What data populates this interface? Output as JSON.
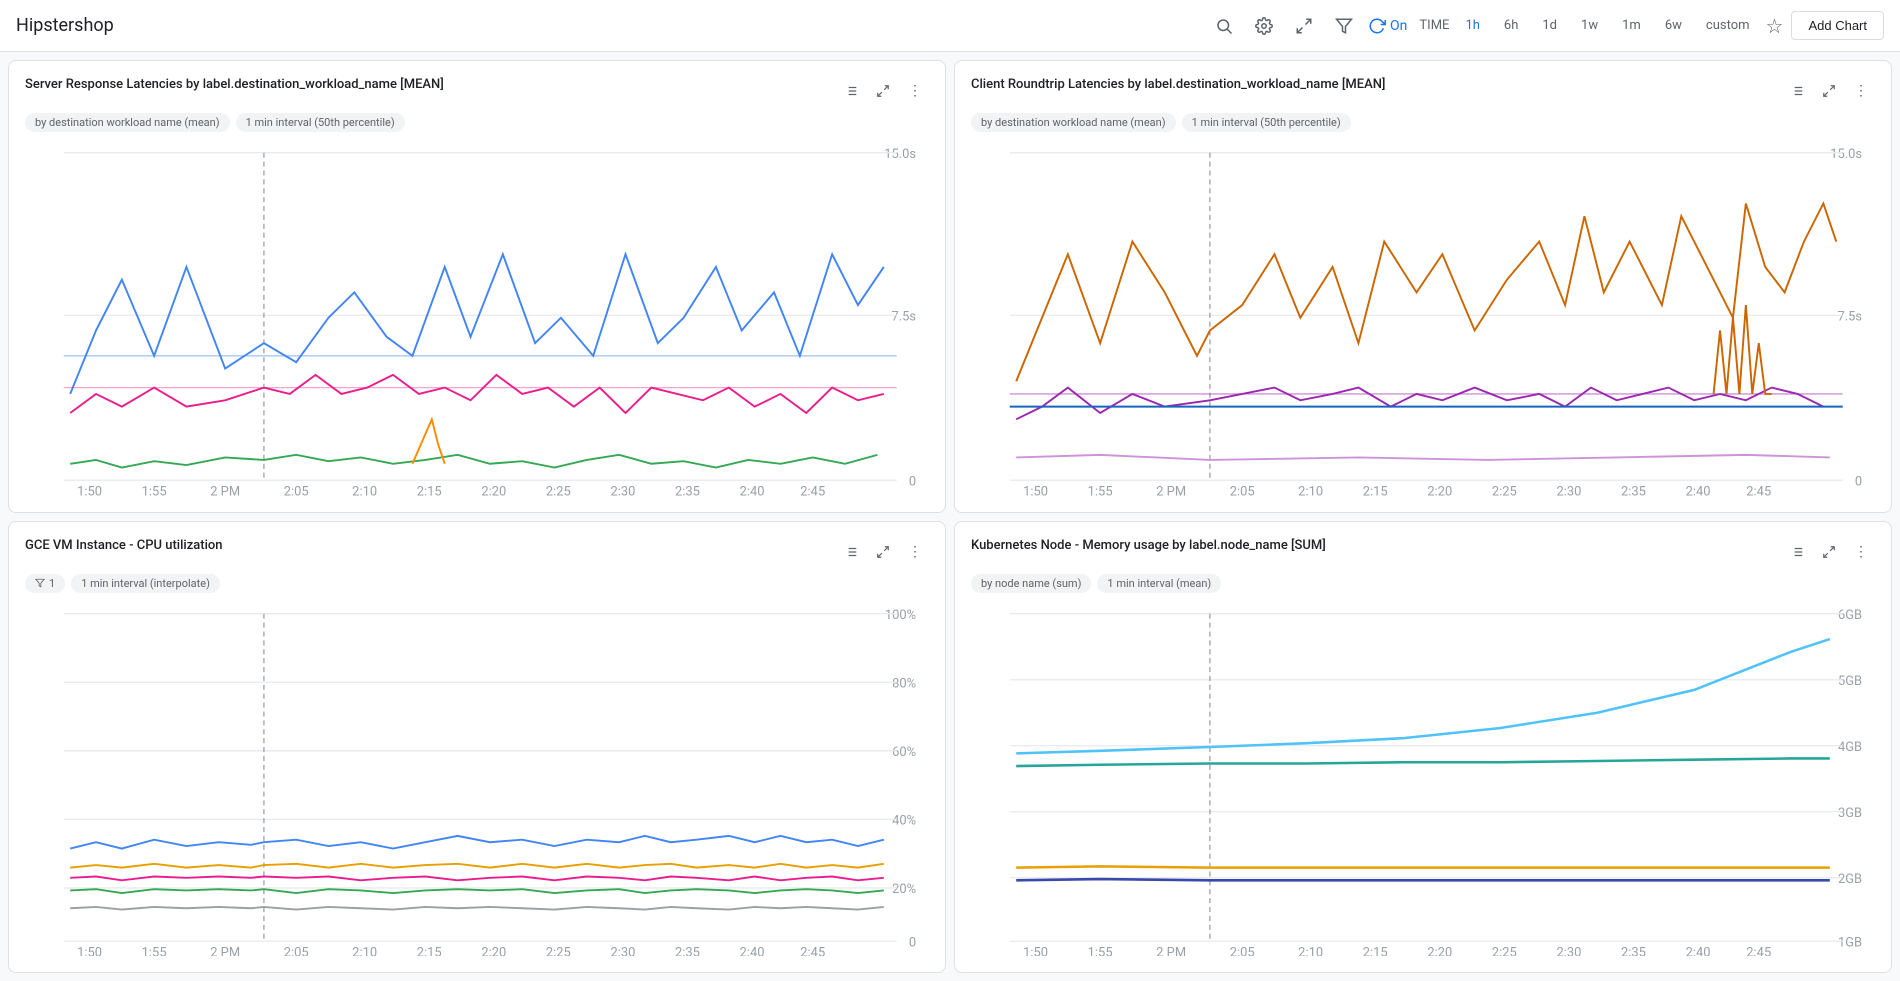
{
  "app": {
    "title": "Hipstershop"
  },
  "toolbar": {
    "refresh_on": "On",
    "time_label": "TIME",
    "time_options": [
      "1h",
      "6h",
      "1d",
      "1w",
      "1m",
      "6w",
      "custom"
    ],
    "active_time": "1h",
    "add_chart_label": "Add Chart"
  },
  "charts": [
    {
      "id": "chart1",
      "title": "Server Response Latencies by label.destination_workload_name [MEAN]",
      "tags": [
        "by destination workload name (mean)",
        "1 min interval (50th percentile)"
      ],
      "y_max": "15.0s",
      "y_mid": "7.5s",
      "y_min": "0",
      "x_labels": [
        "1:50",
        "1:55",
        "2 PM",
        "2:05",
        "2:10",
        "2:15",
        "2:20",
        "2:25",
        "2:30",
        "2:35",
        "2:40",
        "2:45"
      ]
    },
    {
      "id": "chart2",
      "title": "Client Roundtrip Latencies by label.destination_workload_name [MEAN]",
      "tags": [
        "by destination workload name (mean)",
        "1 min interval (50th percentile)"
      ],
      "y_max": "15.0s",
      "y_mid": "7.5s",
      "y_min": "0",
      "x_labels": [
        "1:50",
        "1:55",
        "2 PM",
        "2:05",
        "2:10",
        "2:15",
        "2:20",
        "2:25",
        "2:30",
        "2:35",
        "2:40",
        "2:45"
      ]
    },
    {
      "id": "chart3",
      "title": "GCE VM Instance - CPU utilization",
      "tags": [
        "1",
        "1 min interval (interpolate)"
      ],
      "y_max": "100%",
      "y_mid": "",
      "y_min": "0",
      "x_labels": [
        "1:50",
        "1:55",
        "2 PM",
        "2:05",
        "2:10",
        "2:15",
        "2:20",
        "2:25",
        "2:30",
        "2:35",
        "2:40",
        "2:45"
      ]
    },
    {
      "id": "chart4",
      "title": "Kubernetes Node - Memory usage by label.node_name [SUM]",
      "tags": [
        "by node name (sum)",
        "1 min interval (mean)"
      ],
      "y_max": "6GB",
      "y_mid": "",
      "y_min": "1GB",
      "x_labels": [
        "1:50",
        "1:55",
        "2 PM",
        "2:05",
        "2:10",
        "2:15",
        "2:20",
        "2:25",
        "2:30",
        "2:35",
        "2:40",
        "2:45"
      ]
    }
  ]
}
